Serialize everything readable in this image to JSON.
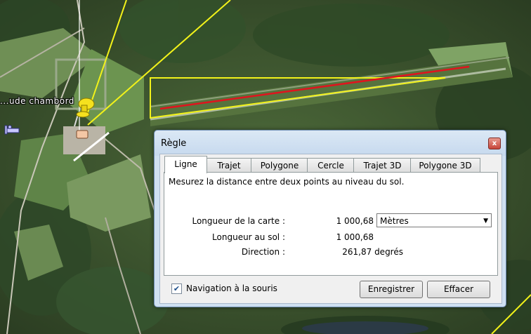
{
  "map": {
    "placemark_label": "...ude chambord"
  },
  "dialog": {
    "title": "Règle",
    "close_glyph": "x",
    "tabs": [
      {
        "label": "Ligne",
        "active": true
      },
      {
        "label": "Trajet",
        "active": false
      },
      {
        "label": "Polygone",
        "active": false
      },
      {
        "label": "Cercle",
        "active": false
      },
      {
        "label": "Trajet 3D",
        "active": false
      },
      {
        "label": "Polygone 3D",
        "active": false
      }
    ],
    "description": "Mesurez la distance entre deux points au niveau du sol.",
    "map_length_label": "Longueur de la carte :",
    "map_length_value": "1 000,68",
    "unit_selected": "Mètres",
    "ground_length_label": "Longueur au sol :",
    "ground_length_value": "1 000,68",
    "direction_label": "Direction :",
    "direction_value": "261,87 degrés",
    "mouse_nav_label": "Navigation à la souris",
    "mouse_nav_checked": true,
    "save_label": "Enregistrer",
    "clear_label": "Effacer"
  },
  "colors": {
    "measure_line": "#e0141e",
    "guide_line": "#f2f21a",
    "dialog_frame": "#cfe0f1"
  }
}
